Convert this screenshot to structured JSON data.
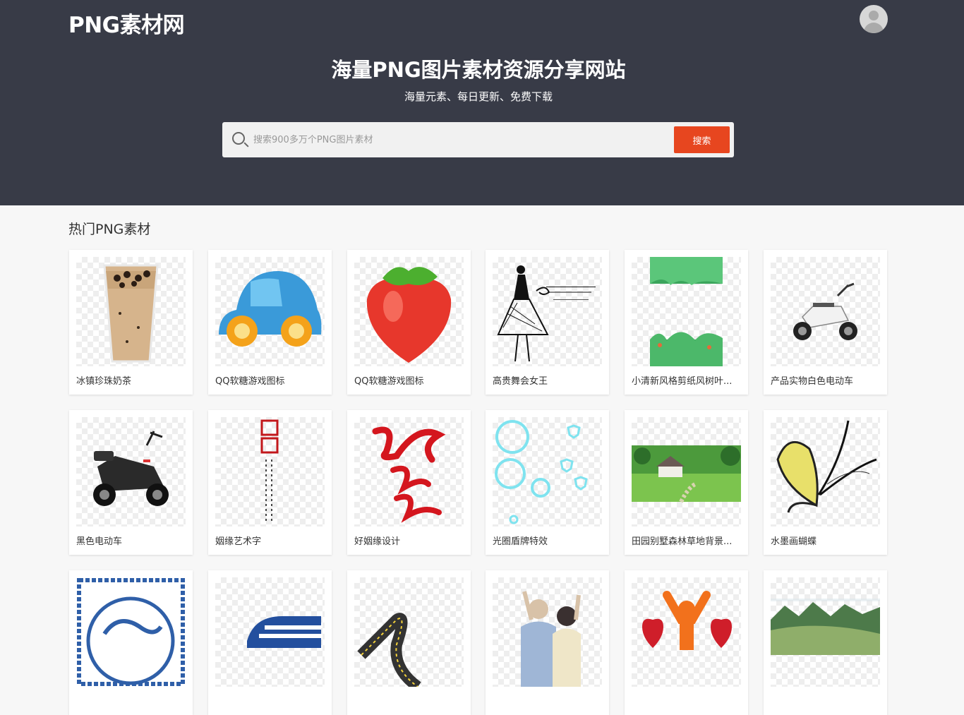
{
  "site": {
    "logo": "PNG素材网",
    "avatar_icon": "user-avatar-icon"
  },
  "hero": {
    "title": "海量PNG图片素材资源分享网站",
    "subtitle": "海量元素、每日更新、免费下载"
  },
  "search": {
    "placeholder": "搜索900多万个PNG图片素材",
    "button_label": "搜索"
  },
  "section": {
    "title": "热门PNG素材"
  },
  "colors": {
    "header_bg": "#383b47",
    "search_button": "#e7461f",
    "page_bg": "#f7f7f7"
  },
  "items": [
    {
      "label": "冰镇珍珠奶茶",
      "icon": "bubble-tea-icon"
    },
    {
      "label": "QQ软糖游戏图标",
      "icon": "jelly-car-icon"
    },
    {
      "label": "QQ软糖游戏图标",
      "icon": "jelly-strawberry-icon"
    },
    {
      "label": "高贵舞会女王",
      "icon": "fashion-lady-icon"
    },
    {
      "label": "小清新风格剪纸风树叶...",
      "icon": "papercut-leaves-icon"
    },
    {
      "label": "产品实物白色电动车",
      "icon": "white-scooter-icon"
    },
    {
      "label": "黑色电动车",
      "icon": "black-scooter-icon"
    },
    {
      "label": "姻缘艺术字",
      "icon": "calligraphy-text-icon"
    },
    {
      "label": "好姻缘设计",
      "icon": "red-calligraphy-icon"
    },
    {
      "label": "光圈盾牌特效",
      "icon": "light-rings-icon"
    },
    {
      "label": "田园别墅森林草地背景...",
      "icon": "villa-landscape-icon"
    },
    {
      "label": "水墨画蝴蝶",
      "icon": "ink-butterfly-icon"
    },
    {
      "label": "",
      "icon": "blue-dragon-plate-icon"
    },
    {
      "label": "",
      "icon": "blue-train-icon"
    },
    {
      "label": "",
      "icon": "winding-road-icon"
    },
    {
      "label": "",
      "icon": "elderly-couple-icon"
    },
    {
      "label": "",
      "icon": "hearts-person-icon"
    },
    {
      "label": "",
      "icon": "mountain-landscape-icon"
    }
  ]
}
